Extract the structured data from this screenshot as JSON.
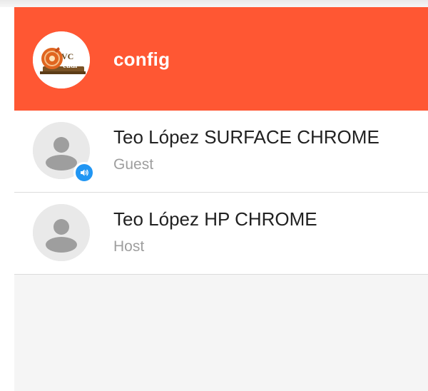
{
  "header": {
    "title": "config",
    "color": "#ff5733",
    "logo": {
      "icon": "vc-cudi-logo",
      "text_line1": "VC",
      "text_line2": "cudi"
    }
  },
  "participants": [
    {
      "name": "Teo López SURFACE CHROME",
      "role": "Guest",
      "avatar_icon": "default-user-icon",
      "audio_badge": true,
      "audio_badge_icon": "speaker-icon",
      "audio_badge_color": "#2196f3"
    },
    {
      "name": "Teo López HP CHROME",
      "role": "Host",
      "avatar_icon": "default-user-icon",
      "audio_badge": false
    }
  ]
}
